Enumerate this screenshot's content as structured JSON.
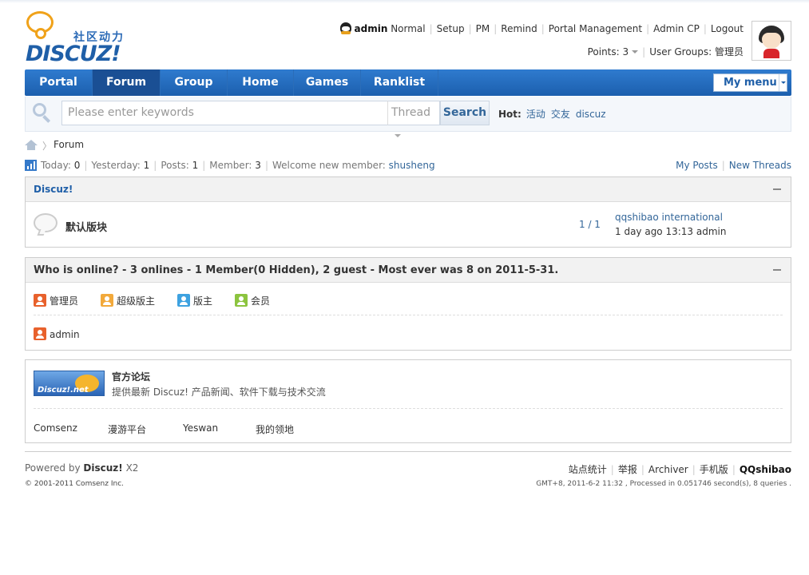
{
  "logo": {
    "cn": "社区动力",
    "en": "DISCUZ!"
  },
  "user": {
    "name": "admin",
    "status": "Normal",
    "links": [
      "Setup",
      "PM",
      "Remind",
      "Portal Management",
      "Admin CP",
      "Logout"
    ],
    "points_label": "Points: 3",
    "groups_label": "User Groups: 管理员"
  },
  "nav": {
    "items": [
      "Portal",
      "Forum",
      "Group",
      "Home",
      "Games",
      "Ranklist"
    ],
    "active": "Forum",
    "mymenu": "My menu"
  },
  "search": {
    "placeholder": "Please enter keywords",
    "type": "Thread",
    "button": "Search",
    "hot_label": "Hot:",
    "hot": [
      "活动",
      "交友",
      "discuz"
    ]
  },
  "breadcrumb": {
    "current": "Forum",
    "separator": "〉"
  },
  "stats": {
    "today_label": "Today:",
    "today": "0",
    "yesterday_label": "Yesterday:",
    "yesterday": "1",
    "posts_label": "Posts:",
    "posts": "1",
    "member_label": "Member:",
    "member": "3",
    "welcome_label": "Welcome new member:",
    "new_member": "shusheng",
    "my_posts": "My Posts",
    "new_threads": "New Threads"
  },
  "category": {
    "title": "Discuz!",
    "forum_name": "默认版块",
    "count": "1 / 1",
    "last_title": "qqshibao international",
    "last_meta": "1 day ago 13:13 admin"
  },
  "online": {
    "title": "Who is online? - 3 onlines - 1 Member(0 Hidden), 2 guest - Most ever was 8 on 2011-5-31.",
    "legend": [
      {
        "label": "管理员",
        "color": "#e8612c"
      },
      {
        "label": "超级版主",
        "color": "#f2a93b"
      },
      {
        "label": "版主",
        "color": "#3ea2e0"
      },
      {
        "label": "会员",
        "color": "#8cc43f"
      }
    ],
    "users": [
      {
        "name": "admin",
        "color": "#e8612c"
      }
    ]
  },
  "links_box": {
    "logo_text": "Discuz!.net",
    "title": "官方论坛",
    "desc": "提供最新 Discuz! 产品新闻、软件下载与技术交流",
    "links": [
      "Comsenz",
      "漫游平台",
      "Yeswan",
      "我的领地"
    ]
  },
  "footer": {
    "powered_label": "Powered by",
    "brand": "Discuz!",
    "version": "X2",
    "copyright": "© 2001-2011 Comsenz Inc.",
    "links": [
      "站点统计",
      "举报",
      "Archiver",
      "手机版"
    ],
    "site": "QQshibao",
    "processed": "GMT+8, 2011-6-2 11:32 , Processed in 0.051746 second(s), 8 queries ."
  },
  "colors": {
    "nav": "#1f64b4",
    "link": "#336699",
    "accent": "#f0a21a"
  }
}
